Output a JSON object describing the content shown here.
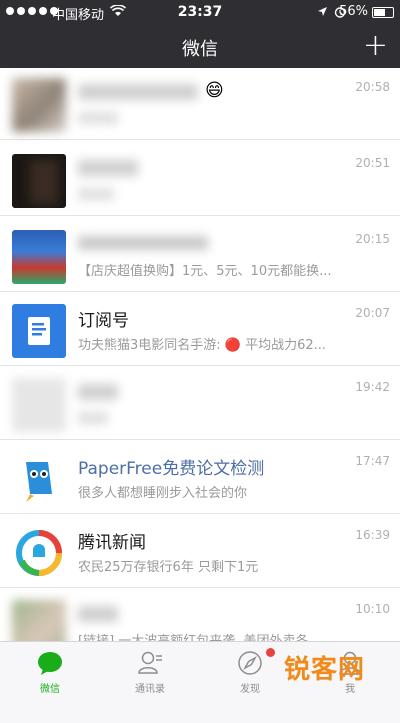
{
  "status_bar": {
    "carrier": "中国移动",
    "time": "23:37",
    "battery": "56%"
  },
  "nav": {
    "title": "微信",
    "plus": "+"
  },
  "chats": [
    {
      "name": "",
      "preview": "",
      "time": "20:58",
      "emoji": "😄"
    },
    {
      "name": "",
      "preview": "",
      "time": "20:51"
    },
    {
      "name": "",
      "preview": "【店庆超值换购】1元、5元、10元都能换...",
      "time": "20:15"
    },
    {
      "name": "订阅号",
      "preview": "功夫熊猫3电影同名手游: 🔴 平均战力62...",
      "time": "20:07"
    },
    {
      "name": "",
      "preview": "",
      "time": "19:42"
    },
    {
      "name": "PaperFree免费论文检测",
      "preview": "很多人都想睡刚步入社会的你",
      "time": "17:47"
    },
    {
      "name": "腾讯新闻",
      "preview": "农民25万存银行6年 只剩下1元",
      "time": "16:39"
    },
    {
      "name": "",
      "preview": "[链接] 一大波高额红包来袭, 美团外卖冬...",
      "time": "10:10"
    }
  ],
  "tabs": [
    {
      "label": "微信",
      "icon": "chat-bubble-icon"
    },
    {
      "label": "通讯录",
      "icon": "contacts-icon"
    },
    {
      "label": "发现",
      "icon": "compass-icon"
    },
    {
      "label": "我",
      "icon": "person-icon"
    }
  ],
  "watermark": {
    "text": "锐客网"
  },
  "colors": {
    "header_bg": "#2e2e33",
    "active_tab": "#1aad19",
    "official_account_name": "#4d6ea8"
  }
}
